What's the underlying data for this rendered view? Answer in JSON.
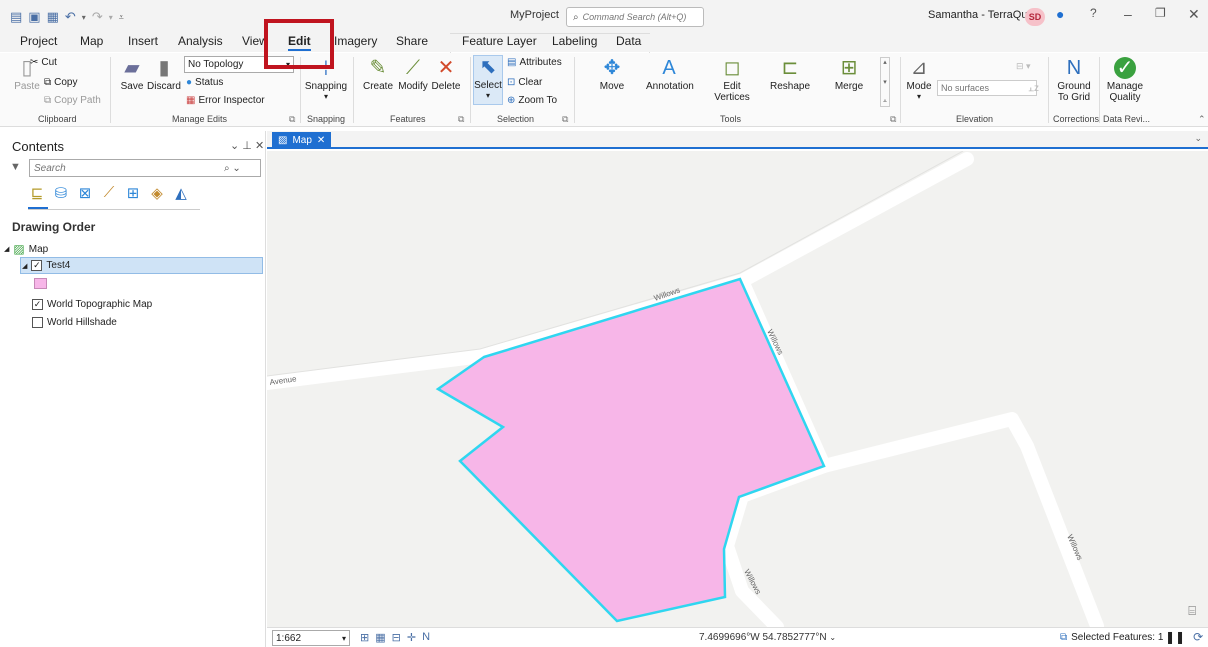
{
  "titlebar": {
    "project": "MyProject",
    "command_search_placeholder": "Command Search (Alt+Q)",
    "user": "Samantha - TerraQuest",
    "user_initials": "SD"
  },
  "tabs": [
    "Project",
    "Map",
    "Insert",
    "Analysis",
    "View",
    "Edit",
    "Imagery",
    "Share",
    "Feature Layer",
    "Labeling",
    "Data"
  ],
  "active_tab": "Edit",
  "ribbon": {
    "clipboard": {
      "paste": "Paste",
      "cut": "Cut",
      "copy": "Copy",
      "copy_path": "Copy Path",
      "label": "Clipboard"
    },
    "manage_edits": {
      "save": "Save",
      "discard": "Discard",
      "topology": "No Topology",
      "status": "Status",
      "error_inspector": "Error Inspector",
      "label": "Manage Edits"
    },
    "snapping": {
      "snapping": "Snapping",
      "label": "Snapping"
    },
    "features": {
      "create": "Create",
      "modify": "Modify",
      "delete": "Delete",
      "label": "Features"
    },
    "selection": {
      "select": "Select",
      "attributes": "Attributes",
      "clear": "Clear",
      "zoom_to": "Zoom To",
      "label": "Selection"
    },
    "tools": {
      "move": "Move",
      "annotation": "Annotation",
      "edit_vertices_1": "Edit",
      "edit_vertices_2": "Vertices",
      "reshape": "Reshape",
      "merge": "Merge",
      "label": "Tools"
    },
    "elevation": {
      "mode": "Mode",
      "surfaces_placeholder": "No surfaces",
      "label": "Elevation"
    },
    "corrections": {
      "ground_1": "Ground",
      "ground_2": "To Grid",
      "label": "Corrections"
    },
    "data_reviewer": {
      "manage_1": "Manage",
      "manage_2": "Quality",
      "label": "Data Revi..."
    }
  },
  "contents": {
    "title": "Contents",
    "search_placeholder": "Search",
    "drawing_order": "Drawing Order",
    "map": "Map",
    "layer_selected": "Test4",
    "layer_topo": "World Topographic Map",
    "layer_hillshade": "World Hillshade"
  },
  "map": {
    "tab": "Map",
    "road_labels": {
      "willows_1": "Willows",
      "willows_2": "Willows",
      "willows_3": "Willows",
      "willows_4": "Willows",
      "avenue": "Avenue"
    }
  },
  "status": {
    "scale": "1:662",
    "coords": "7.4699696°W 54.7852777°N",
    "selected": "Selected Features: 1"
  },
  "colors": {
    "accent": "#1f6fd1",
    "polygon_fill": "#f7b6e8",
    "polygon_outline": "#2fd6f0",
    "highlight": "#c0141f"
  }
}
